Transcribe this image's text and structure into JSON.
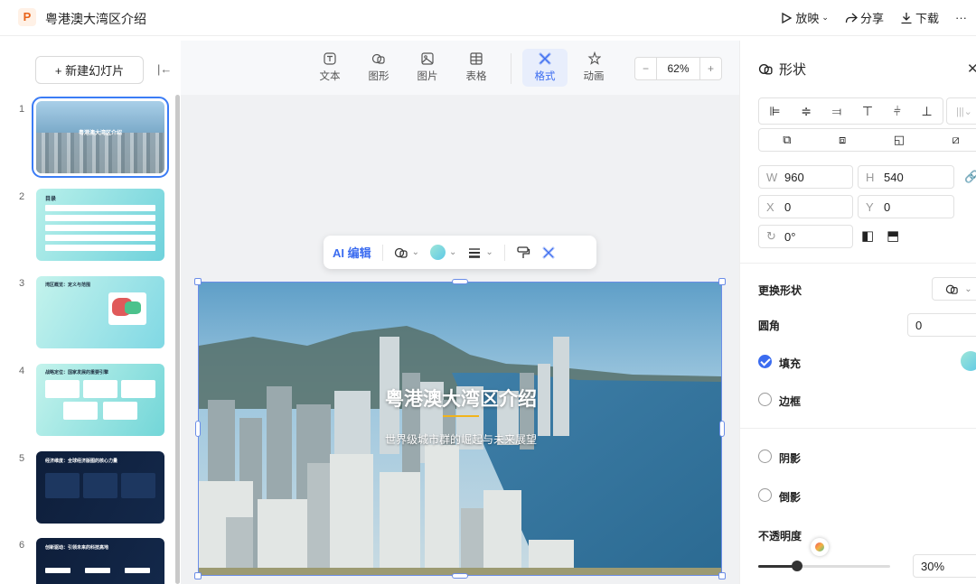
{
  "app": {
    "logo_letter": "P",
    "title": "粤港澳大湾区介绍"
  },
  "top_actions": {
    "play": "放映",
    "share": "分享",
    "download": "下载",
    "more": "···"
  },
  "left_panel": {
    "new_slide_label": "+ 新建幻灯片",
    "slide_numbers": [
      "1",
      "2",
      "3",
      "4",
      "5",
      "6"
    ],
    "slides": [
      {
        "title": "粤港澳大湾区介绍"
      },
      {
        "title": "目录"
      },
      {
        "title": "湾区概览：定义与范围"
      },
      {
        "title": "战略定位：国家发展的重要引擎"
      },
      {
        "title": "经济维度：全球经济版图的核心力量"
      },
      {
        "title": "创新驱动：引领未来的科技高地"
      }
    ]
  },
  "toolbar": {
    "tools": [
      "文本",
      "图形",
      "图片",
      "表格",
      "格式",
      "动画"
    ],
    "active_tool": "格式",
    "zoom_minus": "−",
    "zoom_value": "62%",
    "zoom_plus": "+"
  },
  "float_bar": {
    "ai_edit": "AI 编辑"
  },
  "slide": {
    "title": "粤港澳大湾区介绍",
    "subtitle": "世界级城市群的崛起与未来展望"
  },
  "right_panel": {
    "title": "形状",
    "close": "✕",
    "w_label": "W",
    "w_value": "960",
    "h_label": "H",
    "h_value": "540",
    "x_label": "X",
    "x_value": "0",
    "y_label": "Y",
    "y_value": "0",
    "rotation_value": "0°",
    "replace_shape": "更换形状",
    "corner_radius": "圆角",
    "corner_radius_value": "0",
    "fill": "填充",
    "border": "边框",
    "shadow": "阴影",
    "reflection": "倒影",
    "opacity": "不透明度",
    "opacity_value": "30%",
    "opacity_level": 0.3,
    "fill_color": "#7ee0d8"
  }
}
